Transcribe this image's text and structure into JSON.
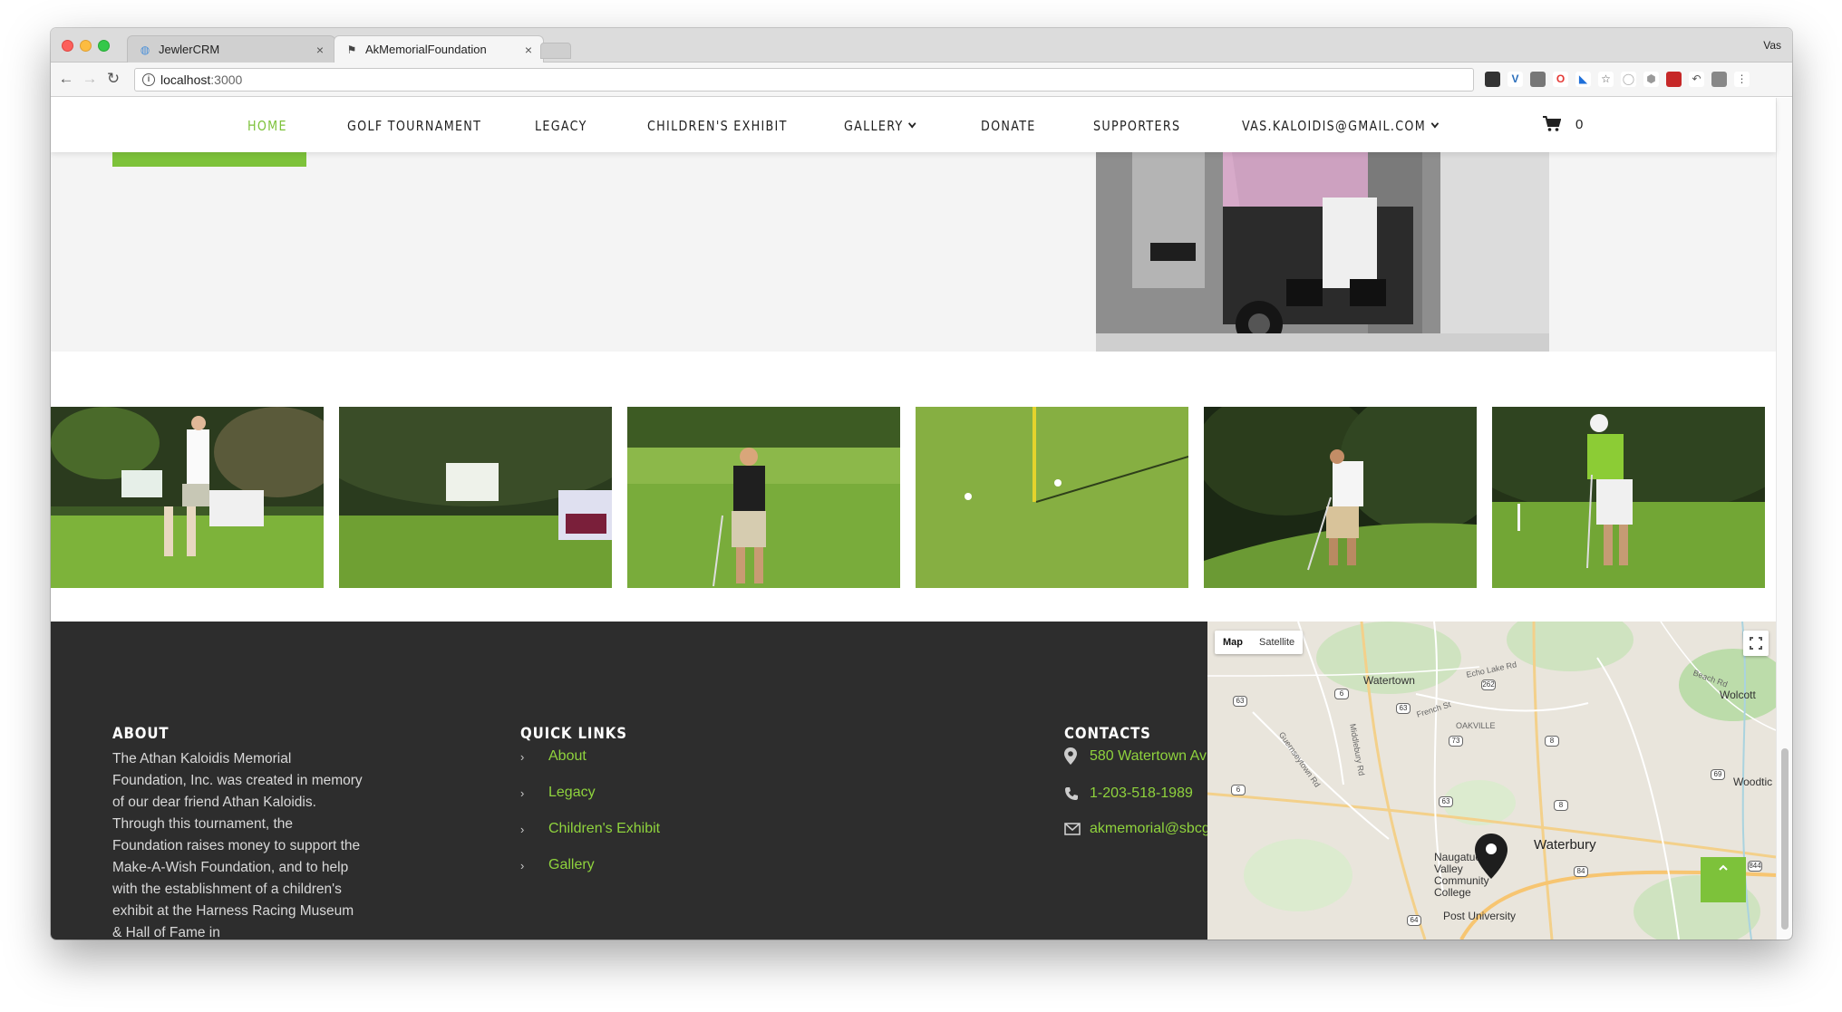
{
  "browser": {
    "tabs": [
      {
        "title": "JewlerCRM",
        "close": "×"
      },
      {
        "title": "AkMemorialFoundation",
        "close": "×"
      }
    ],
    "profile": "Vas",
    "url": {
      "host": "localhost",
      "port": ":3000"
    }
  },
  "nav": {
    "items": [
      {
        "label": "HOME",
        "active": true
      },
      {
        "label": "GOLF TOURNAMENT"
      },
      {
        "label": "LEGACY"
      },
      {
        "label": "CHILDREN'S EXHIBIT"
      },
      {
        "label": "GALLERY"
      },
      {
        "label": "DONATE"
      },
      {
        "label": "SUPPORTERS"
      },
      {
        "label": "VAS.KALOIDIS@GMAIL.COM"
      }
    ],
    "cart_count": "0"
  },
  "footer": {
    "about": {
      "heading": "ABOUT",
      "text": "The Athan Kaloidis Memorial Foundation, Inc. was created in memory of our dear friend Athan Kaloidis. Through this tournament, the Foundation raises money to support the Make-A-Wish Foundation, and to help with the establishment of a children's exhibit at the Harness Racing Museum & Hall of Fame in"
    },
    "quick_links": {
      "heading": "QUICK LINKS",
      "links": [
        "About",
        "Legacy",
        "Children's Exhibit",
        "Gallery"
      ]
    },
    "contacts": {
      "heading": "CONTACTS",
      "address": "580 Watertown Av",
      "phone": "1-203-518-1989",
      "email": "akmemorial@sbcg"
    }
  },
  "map": {
    "type_buttons": [
      "Map",
      "Satellite"
    ],
    "labels": {
      "watertown": "Watertown",
      "wolcott": "Wolcott",
      "oakville": "OAKVILLE",
      "waterbury": "Waterbury",
      "naugatuck": "Naugatuck Valley Community College",
      "post": "Post University",
      "woodtick": "Woodtic",
      "echo": "Echo Lake Rd",
      "french": "French St",
      "beach": "Beach Rd",
      "middlebury": "Middlebury Rd",
      "guernseytown": "Guernseytown Rd"
    },
    "routes": [
      "6",
      "262",
      "63",
      "61",
      "6",
      "8",
      "73",
      "63",
      "69",
      "8",
      "84",
      "844",
      "64",
      "84"
    ]
  },
  "colors": {
    "accent": "#7dc23a",
    "link": "#8fd33d",
    "footer_bg": "#2d2d2d"
  }
}
